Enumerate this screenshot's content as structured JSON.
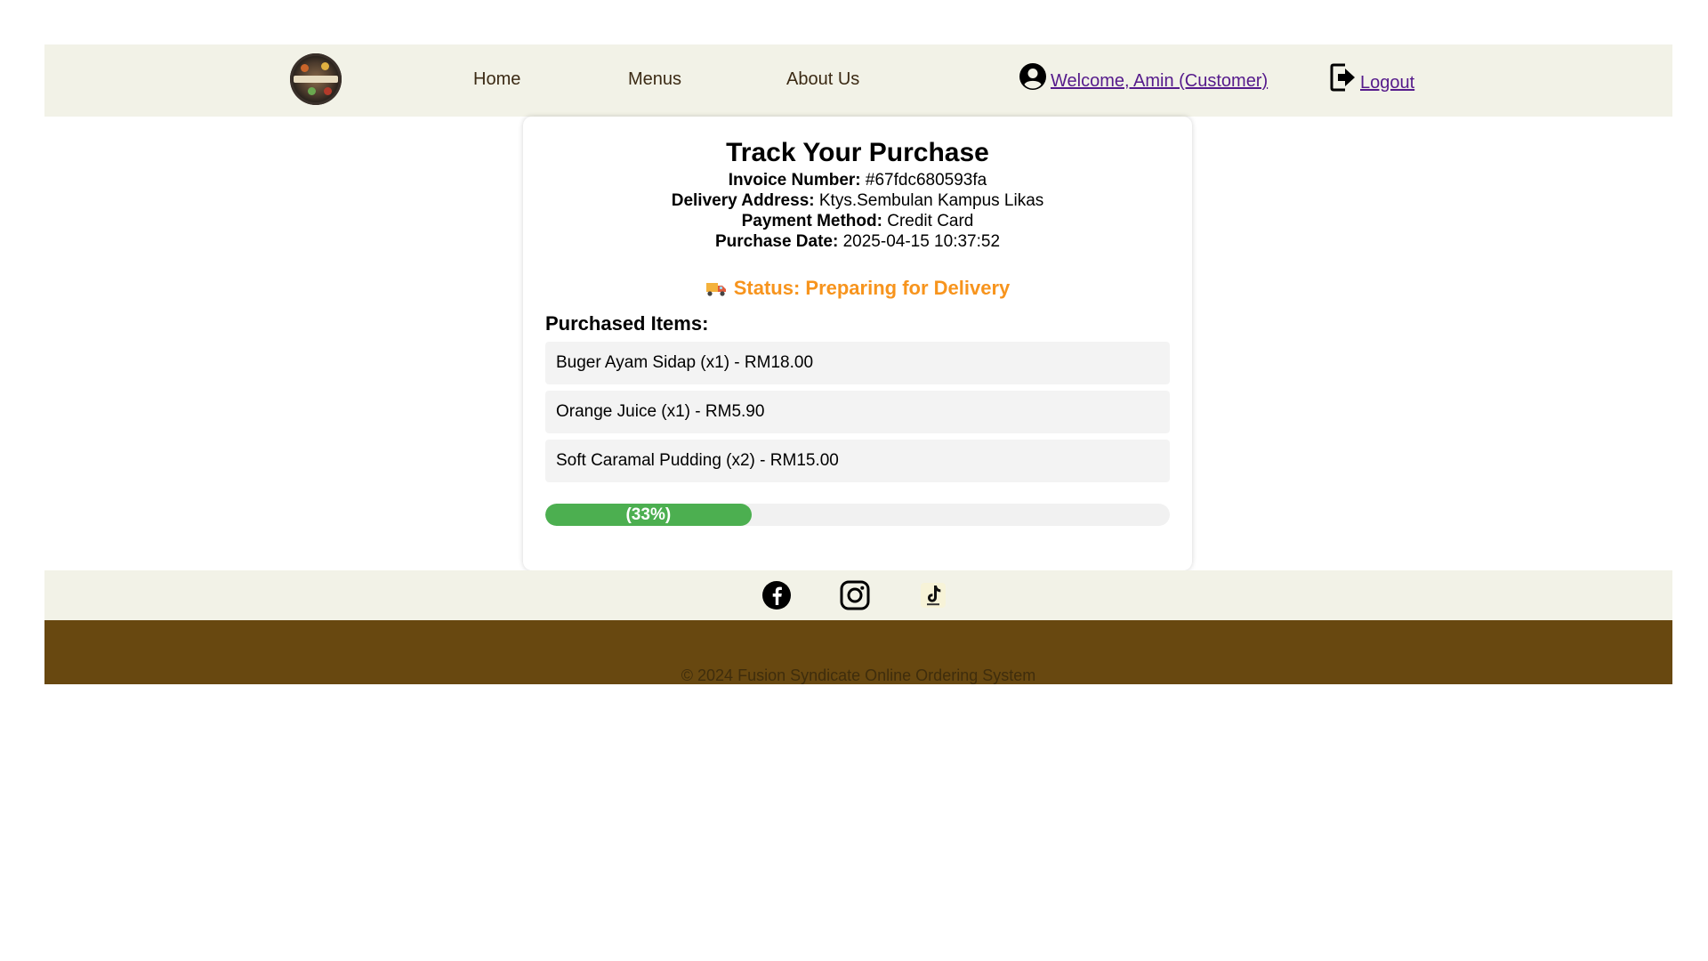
{
  "nav": {
    "home": "Home",
    "menus": "Menus",
    "about": "About Us",
    "welcome": "Welcome, Amin (Customer)",
    "logout": "Logout"
  },
  "icons": {
    "logo": "restaurant-logo-icon",
    "user": "user-circle-icon",
    "logout": "logout-icon",
    "truck": "delivery-truck-icon",
    "facebook": "facebook-icon",
    "instagram": "instagram-icon",
    "tiktok": "tiktok-icon"
  },
  "purchase": {
    "title": "Track Your Purchase",
    "invoice_label": "Invoice Number:",
    "invoice_value": "#67fdc680593fa",
    "address_label": "Delivery Address:",
    "address_value": "Ktys.Sembulan Kampus Likas",
    "payment_label": "Payment Method:",
    "payment_value": "Credit Card",
    "date_label": "Purchase Date:",
    "date_value": "2025-04-15 10:37:52",
    "status": "Status: Preparing for Delivery",
    "items_title": "Purchased Items:",
    "items": [
      "Buger Ayam Sidap (x1) - RM18.00",
      "Orange Juice (x1) - RM5.90",
      "Soft Caramal Pudding (x2) - RM15.00"
    ],
    "progress_percent": 33,
    "progress_label": "(33%)"
  },
  "footer": {
    "copyright": "© 2024 Fusion Syndicate Online Ordering System"
  },
  "colors": {
    "nav_bg": "#f2f2e7",
    "footer_bg": "#684810",
    "status": "#f7941d",
    "progress": "#4caf50",
    "link_visited": "#551a8b"
  }
}
